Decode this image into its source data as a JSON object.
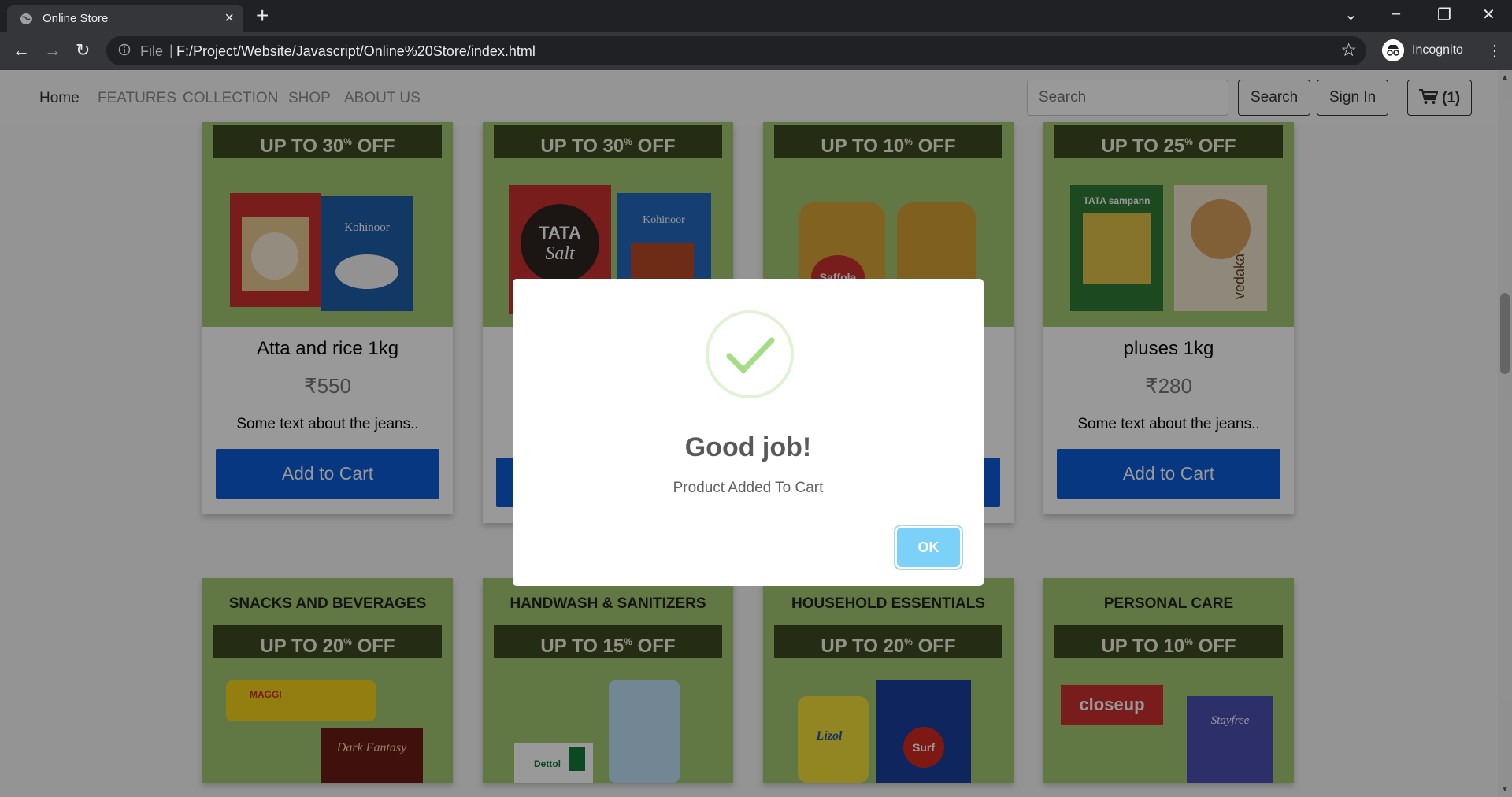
{
  "browser": {
    "tab_title": "Online Store",
    "tab_close": "×",
    "new_tab": "+",
    "file_label": "File",
    "url": "F:/Project/Website/Javascript/Online%20Store/index.html",
    "incognito_label": "Incognito"
  },
  "nav": {
    "links": [
      "Home",
      "FEATURES",
      "COLLECTION",
      "SHOP",
      "ABOUT US"
    ],
    "search_placeholder": "Search",
    "search_button": "Search",
    "signin_button": "Sign In",
    "cart_count": "(1)"
  },
  "products_top": [
    {
      "offer": "UP TO 30",
      "offer_suffix": "% OFF",
      "name": "Atta and rice 1kg",
      "price": "₹550",
      "desc": "Some text about the jeans..",
      "button": "Add to Cart"
    },
    {
      "offer": "UP TO 30",
      "offer_suffix": "% OFF",
      "button": ""
    },
    {
      "offer": "UP TO 10",
      "offer_suffix": "% OFF",
      "button": ""
    },
    {
      "offer": "UP TO 25",
      "offer_suffix": "% OFF",
      "name": "pluses 1kg",
      "price": "₹280",
      "desc": "Some text about the jeans..",
      "button": "Add to Cart"
    }
  ],
  "products_bottom": [
    {
      "category": "SNACKS AND BEVERAGES",
      "offer": "UP TO 20",
      "offer_suffix": "% OFF"
    },
    {
      "category": "HANDWASH & SANITIZERS",
      "offer": "UP TO 15",
      "offer_suffix": "% OFF"
    },
    {
      "category": "HOUSEHOLD ESSENTIALS",
      "offer": "UP TO 20",
      "offer_suffix": "% OFF"
    },
    {
      "category": "PERSONAL CARE",
      "offer": "UP TO 10",
      "offer_suffix": "% OFF"
    }
  ],
  "product_art_text": {
    "tata": "TATA",
    "salt": "Salt",
    "kohinoor": "Kohinoor",
    "saffola": "Saffola",
    "tata_sampann": "TATA sampann",
    "vedaka": "vedaka",
    "maggi": "MAGGI",
    "dark_fantasy": "Dark Fantasy",
    "dettol": "Dettol",
    "lizol": "Lizol",
    "surf": "Surf",
    "closeup": "closeup",
    "stayfree": "Stayfree"
  },
  "modal": {
    "title": "Good job!",
    "text": "Product Added To Cart",
    "ok": "OK"
  },
  "colors": {
    "banner_green": "#a3c872",
    "ribbon_dark": "#3d4a22",
    "cart_button": "#0b5cd5",
    "ok_button": "#7cd1f9",
    "check_green": "#a5dc86"
  }
}
